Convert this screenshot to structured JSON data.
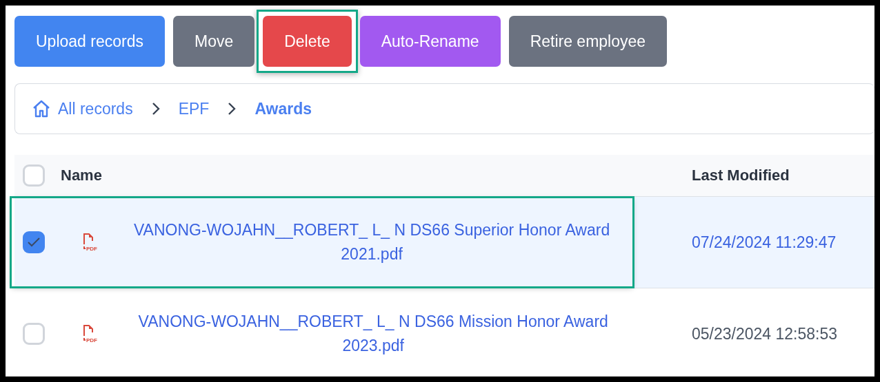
{
  "toolbar": {
    "buttons": [
      {
        "label": "Upload records",
        "kind": "primary",
        "highlighted": false
      },
      {
        "label": "Move",
        "kind": "neutral",
        "highlighted": false
      },
      {
        "label": "Delete",
        "kind": "danger",
        "highlighted": true
      },
      {
        "label": "Auto-Rename",
        "kind": "accent",
        "highlighted": false
      },
      {
        "label": "Retire employee",
        "kind": "neutral",
        "highlighted": false
      }
    ]
  },
  "breadcrumb": [
    {
      "label": "All records",
      "kind": "home"
    },
    {
      "label": "EPF",
      "kind": "link"
    },
    {
      "label": "Awards",
      "kind": "current"
    }
  ],
  "table": {
    "select_all": {
      "checked": false
    },
    "columns": [
      "Name",
      "Last Modified"
    ],
    "rows": [
      {
        "checked": true,
        "selected": true,
        "highlighted": true,
        "file_badge": "PDF",
        "name": "VANONG-WOJAHN__ROBERT_ L_ N DS66 Superior Honor Award 2021.pdf",
        "modified": "07/24/2024 11:29:47"
      },
      {
        "checked": false,
        "selected": false,
        "highlighted": false,
        "file_badge": "PDF",
        "name": "VANONG-WOJAHN__ROBERT_ L_ N DS66 Mission Honor Award 2023.pdf",
        "modified": "05/23/2024 12:58:53"
      }
    ]
  }
}
